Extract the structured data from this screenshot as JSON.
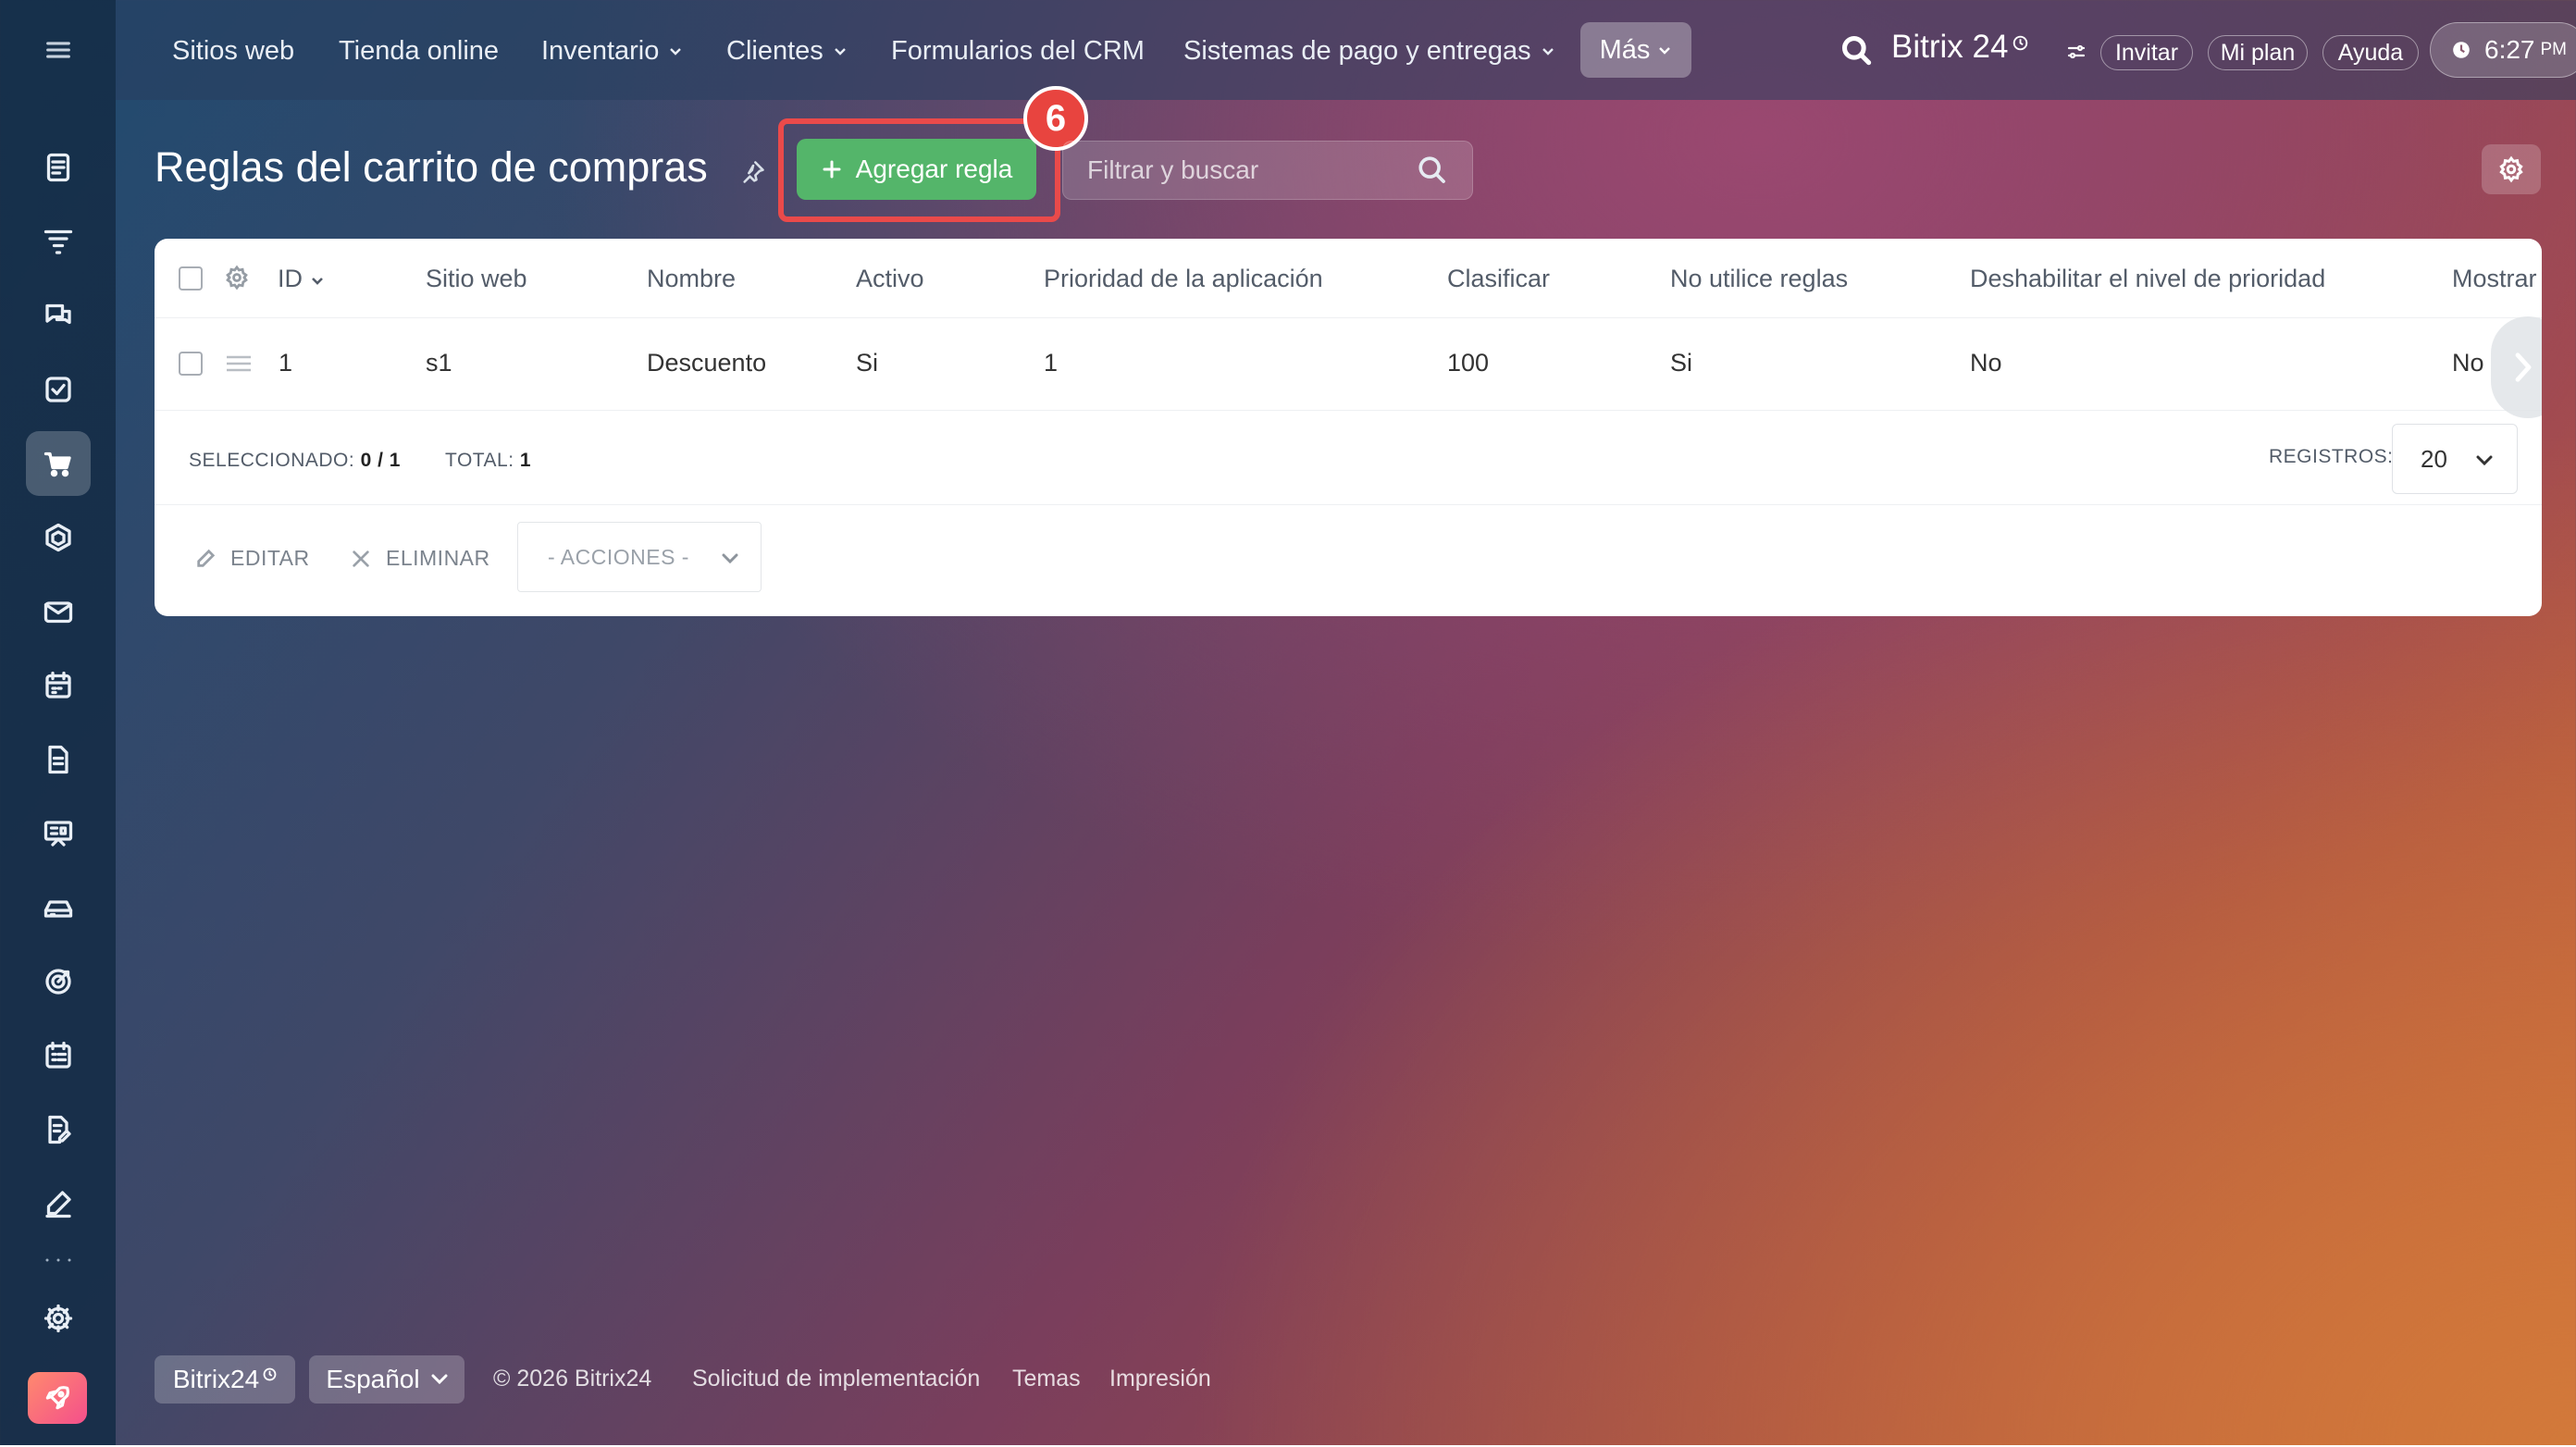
{
  "topnav": {
    "items": [
      {
        "label": "Sitios web",
        "dropdown": false
      },
      {
        "label": "Tienda online",
        "dropdown": false
      },
      {
        "label": "Inventario",
        "dropdown": true
      },
      {
        "label": "Clientes",
        "dropdown": true
      },
      {
        "label": "Formularios del CRM",
        "dropdown": false
      },
      {
        "label": "Sistemas de pago y entregas",
        "dropdown": true
      }
    ],
    "more_label": "Más",
    "brand": "Bitrix 24",
    "invite": "Invitar",
    "my_plan": "Mi plan",
    "help": "Ayuda",
    "time": "6:27",
    "ampm": "PM"
  },
  "sidebar": {
    "icons": [
      "menu-icon",
      "feed-icon",
      "funnel-icon",
      "chat-icon",
      "tasks-icon",
      "cart-icon",
      "hexagon-icon",
      "mail-icon",
      "calendar-icon",
      "document-icon",
      "presentation-icon",
      "storage-icon",
      "target-icon",
      "planner-icon",
      "sign-doc-icon",
      "pen-icon",
      "settings-icon",
      "rocket-icon"
    ],
    "active": "cart-icon"
  },
  "page": {
    "title": "Reglas del carrito de compras",
    "add_button": "Agregar regla",
    "step_number": "6",
    "filter_placeholder": "Filtrar y buscar"
  },
  "grid": {
    "columns": [
      "ID",
      "Sitio web",
      "Nombre",
      "Activo",
      "Prioridad de la aplicación",
      "Clasificar",
      "No utilice reglas",
      "Deshabilitar el nivel de prioridad",
      "Mostrar"
    ],
    "rows": [
      {
        "id": "1",
        "site": "s1",
        "name": "Descuento",
        "active": "Si",
        "priority": "1",
        "sort": "100",
        "no_rules": "Si",
        "disable_priority": "No",
        "show": "No"
      }
    ],
    "selected_label": "SELECCIONADO:",
    "selected_value": "0 / 1",
    "total_label": "TOTAL:",
    "total_value": "1",
    "records_label": "REGISTROS:",
    "records_value": "20",
    "edit_label": "EDITAR",
    "delete_label": "ELIMINAR",
    "actions_label": "- ACCIONES -"
  },
  "footer": {
    "brand": "Bitrix24",
    "language": "Español",
    "copyright": "© 2026 Bitrix24",
    "links": [
      "Solicitud de implementación",
      "Temas",
      "Impresión"
    ]
  },
  "colors": {
    "accent_green": "#54b56a",
    "highlight_red": "#ea4a4a",
    "link_blue": "#2067b0"
  }
}
